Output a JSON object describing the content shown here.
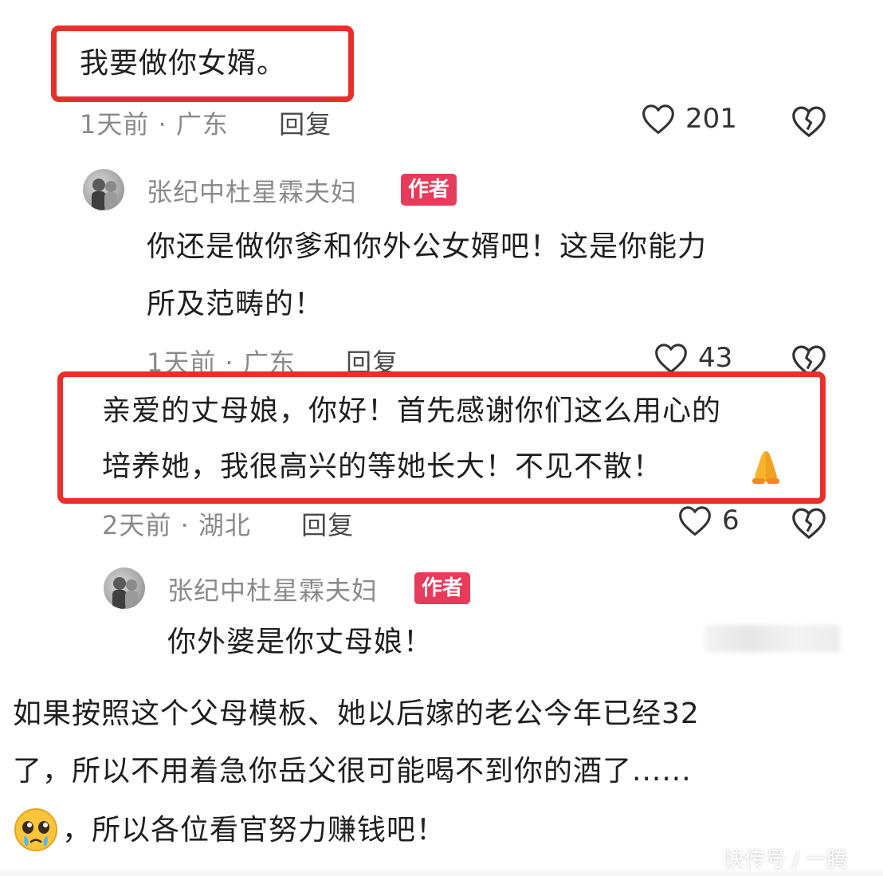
{
  "comment1": {
    "text": "我要做你女婿。",
    "meta_time": "1天前 · 广东",
    "reply_label": "回复",
    "likes": "201"
  },
  "reply1": {
    "author": "张纪中杜星霖夫妇",
    "badge": "作者",
    "line1": "你还是做你爹和你外公女婿吧！这是你能力",
    "line2": "所及范畴的！",
    "meta_time": "1天前 · 广东",
    "reply_label": "回复",
    "likes": "43"
  },
  "comment2": {
    "line1": "亲爱的丈母娘，你好！首先感谢你们这么用心的",
    "line2": "培养她，我很高兴的等她长大！不见不散！",
    "meta_time": "2天前 · 湖北",
    "reply_label": "回复",
    "likes": "6"
  },
  "reply2": {
    "author": "张纪中杜星霖夫妇",
    "badge": "作者",
    "text": "你外婆是你丈母娘！"
  },
  "caption": {
    "line1": "如果按照这个父母模板、她以后嫁的老公今年已经32",
    "line2": "了，所以不用着急你岳父很可能喝不到你的酒了......",
    "line3": "，所以各位看官努力赚钱吧！"
  },
  "watermark": "快传号 / 一腾",
  "colors": {
    "highlight": "#e8302a",
    "badge": "#e83a5a",
    "meta": "#8a8a8a"
  },
  "icons": {
    "like": "heart-outline-icon",
    "dislike": "broken-heart-icon",
    "pray": "folded-hands-emoji",
    "sad": "pleading-face-emoji"
  }
}
